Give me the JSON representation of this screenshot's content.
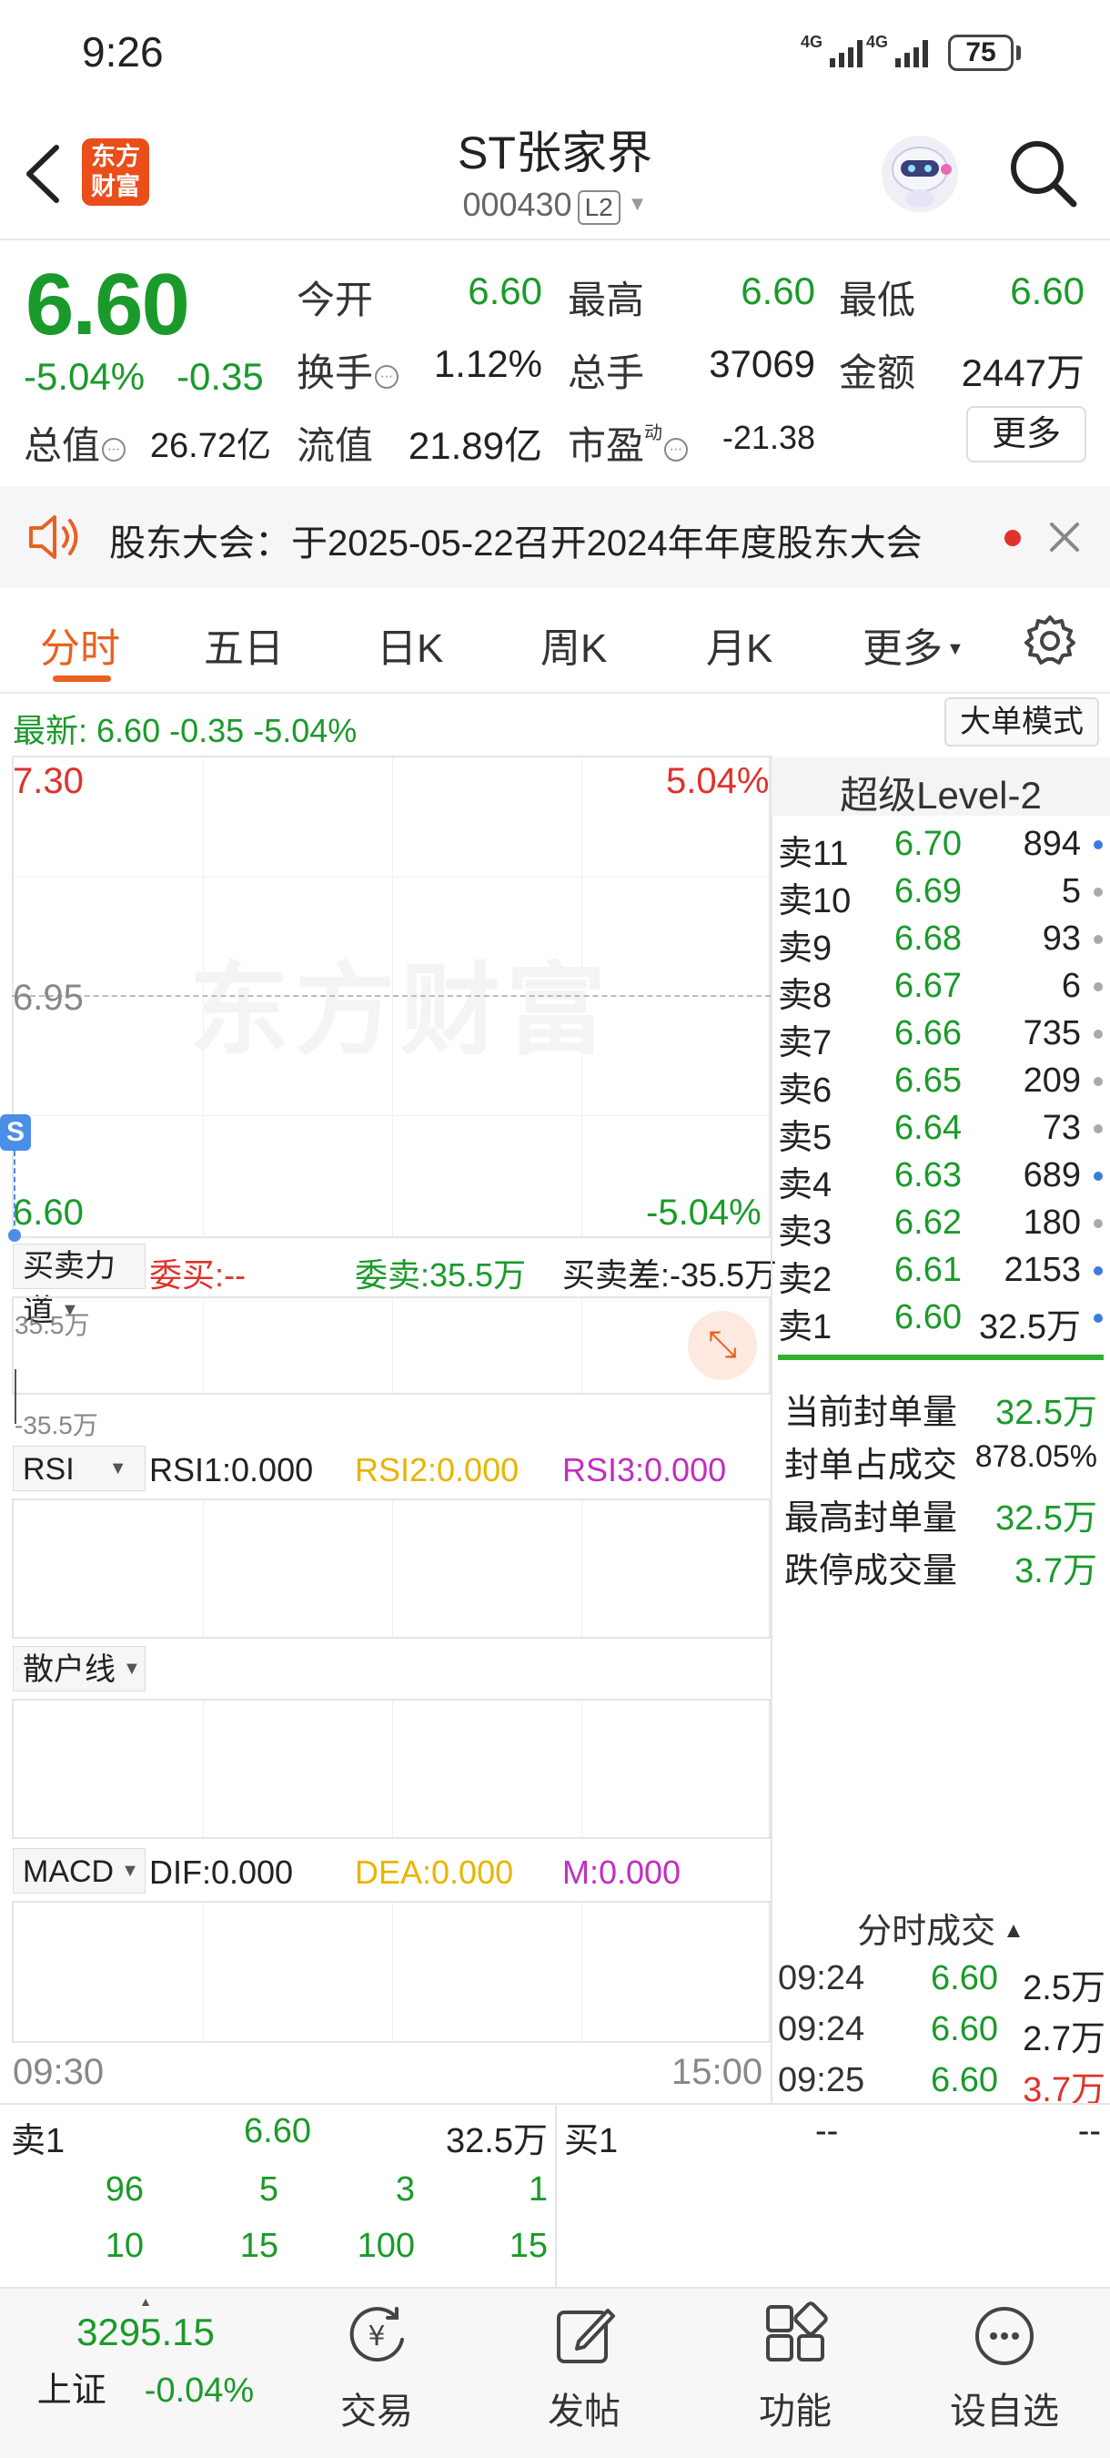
{
  "status_bar": {
    "time": "9:26",
    "signal1": "4G",
    "signal2": "4G",
    "battery": "75"
  },
  "header": {
    "logo_line1": "东方",
    "logo_line2": "财富",
    "stock_name": "ST张家界",
    "stock_code": "000430",
    "level_badge": "L2"
  },
  "quote": {
    "last_price": "6.60",
    "change_pct": "-5.04%",
    "change": "-0.35",
    "open_label": "今开",
    "open": "6.60",
    "high_label": "最高",
    "high": "6.60",
    "low_label": "最低",
    "low": "6.60",
    "turnover_label": "换手",
    "turnover": "1.12%",
    "volume_label": "总手",
    "volume": "37069",
    "amount_label": "金额",
    "amount": "2447万",
    "mktcap_label": "总值",
    "mktcap": "26.72亿",
    "float_label": "流值",
    "float_cap": "21.89亿",
    "pe_label": "市盈",
    "pe_sup": "动",
    "pe": "-21.38",
    "more_label": "更多"
  },
  "notice": {
    "text": "股东大会：于2025-05-22召开2024年年度股东大会"
  },
  "tabs": [
    "分时",
    "五日",
    "日K",
    "周K",
    "月K",
    "更多"
  ],
  "latest": {
    "label": "最新:",
    "price": "6.60",
    "change": "-0.35",
    "pct": "-5.04%",
    "big_order_button": "大单模式"
  },
  "chart": {
    "watermark": "东方财富",
    "price_top": "7.30",
    "pct_top": "5.04%",
    "price_mid": "6.95",
    "price_bottom": "6.60",
    "pct_bottom": "-5.04%",
    "marker": "S",
    "time_start": "09:30",
    "time_end": "15:00"
  },
  "indicators": {
    "buysell": {
      "selector": "买卖力道",
      "buy": "委买:--",
      "sell": "委卖:35.5万",
      "diff": "买卖差:-35.5万",
      "axis_top": "35.5万",
      "axis_bottom": "-35.5万"
    },
    "rsi": {
      "selector": "RSI",
      "rsi1": "RSI1:0.000",
      "rsi2": "RSI2:0.000",
      "rsi3": "RSI3:0.000"
    },
    "retail": {
      "selector": "散户线"
    },
    "macd": {
      "selector": "MACD",
      "dif": "DIF:0.000",
      "dea": "DEA:0.000",
      "m": "M:0.000"
    }
  },
  "level2": {
    "title": "超级Level-2",
    "asks": [
      {
        "label": "卖11",
        "price": "6.70",
        "vol": "894",
        "dot": "#3a7be0"
      },
      {
        "label": "卖10",
        "price": "6.69",
        "vol": "5",
        "dot": "#aaaaaa"
      },
      {
        "label": "卖9",
        "price": "6.68",
        "vol": "93",
        "dot": "#aaaaaa"
      },
      {
        "label": "卖8",
        "price": "6.67",
        "vol": "6",
        "dot": "#aaaaaa"
      },
      {
        "label": "卖7",
        "price": "6.66",
        "vol": "735",
        "dot": "#aaaaaa"
      },
      {
        "label": "卖6",
        "price": "6.65",
        "vol": "209",
        "dot": "#aaaaaa"
      },
      {
        "label": "卖5",
        "price": "6.64",
        "vol": "73",
        "dot": "#aaaaaa"
      },
      {
        "label": "卖4",
        "price": "6.63",
        "vol": "689",
        "dot": "#3a7be0"
      },
      {
        "label": "卖3",
        "price": "6.62",
        "vol": "180",
        "dot": "#aaaaaa"
      },
      {
        "label": "卖2",
        "price": "6.61",
        "vol": "2153",
        "dot": "#3a7be0"
      },
      {
        "label": "卖1",
        "price": "6.60",
        "vol": "32.5万",
        "dot": "#3a7be0"
      }
    ],
    "stats": [
      {
        "label": "当前封单量",
        "value": "32.5万",
        "color": "#1a9a2a"
      },
      {
        "label": "封单占成交",
        "value": "878.05%",
        "color": "#222222"
      },
      {
        "label": "最高封单量",
        "value": "32.5万",
        "color": "#1a9a2a"
      },
      {
        "label": "跌停成交量",
        "value": "3.7万",
        "color": "#1a9a2a"
      }
    ],
    "trades_title": "分时成交",
    "trades": [
      {
        "time": "09:24",
        "price": "6.60",
        "vol": "2.5万",
        "color": "#222222"
      },
      {
        "time": "09:24",
        "price": "6.60",
        "vol": "2.7万",
        "color": "#222222"
      },
      {
        "time": "09:25",
        "price": "6.60",
        "vol": "3.7万",
        "color": "#e0312a"
      }
    ]
  },
  "book": {
    "sell1_label": "卖1",
    "sell1_price": "6.60",
    "sell1_vol": "32.5万",
    "buy1_label": "买1",
    "buy1_price": "--",
    "buy1_vol": "--",
    "queue_row1": [
      "96",
      "5",
      "3",
      "1"
    ],
    "queue_row2": [
      "10",
      "15",
      "100",
      "15"
    ]
  },
  "nav": {
    "index_value": "3295.15",
    "index_name": "上证",
    "index_change": "-0.04%",
    "items": [
      "交易",
      "发帖",
      "功能",
      "设自选"
    ]
  },
  "colors": {
    "up": "#e0312a",
    "down": "#1a9a2a",
    "accent": "#e9611e"
  }
}
